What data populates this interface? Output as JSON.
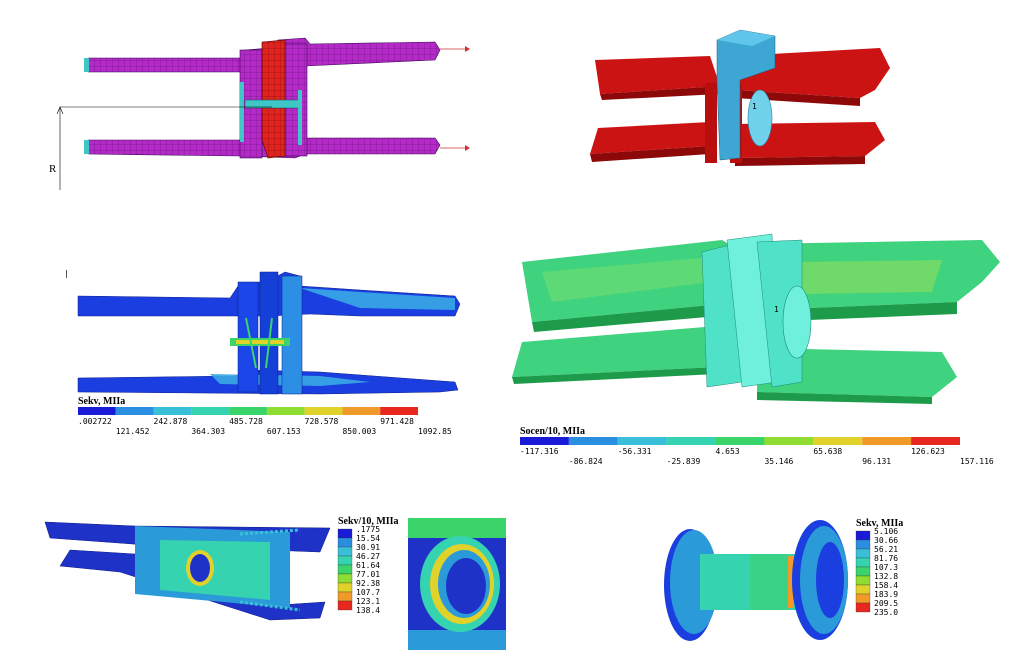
{
  "panel1": {
    "radius_label": "R"
  },
  "panel2": {
    "marker": "1"
  },
  "panel3": {
    "marker": "|",
    "scale_title": "Sekv, MIIa",
    "colors": [
      "#1a1ad9",
      "#2a8fe0",
      "#39c0d8",
      "#35d3b0",
      "#3bd46a",
      "#8fdc32",
      "#e0d22a",
      "#f09a2a",
      "#e8271e"
    ],
    "ticks_top": [
      ".002722",
      "242.878",
      "485.728",
      "728.578",
      "971.428"
    ],
    "ticks_bottom": [
      "121.452",
      "364.303",
      "607.153",
      "850.003",
      "1092.85"
    ]
  },
  "panel4": {
    "marker": "1",
    "scale_title": "Socen/10, MIIa",
    "colors": [
      "#1a1ad9",
      "#2a8fe0",
      "#39c0d8",
      "#35d3b0",
      "#3bd46a",
      "#8fdc32",
      "#e0d22a",
      "#f09a2a",
      "#e8271e"
    ],
    "ticks_top": [
      "-117.316",
      "-56.331",
      "4.653",
      "65.638",
      "126.623"
    ],
    "ticks_bottom": [
      "-86.824",
      "-25.839",
      "35.146",
      "96.131",
      "157.116"
    ]
  },
  "panel5": {
    "scale_title": "Sekv/10, MIIa",
    "colors": [
      "#1a1ad9",
      "#2a8fe0",
      "#39c0d8",
      "#35d3b0",
      "#3bd46a",
      "#8fdc32",
      "#e0d22a",
      "#f09a2a",
      "#e8271e"
    ],
    "values": [
      ".1775",
      "15.54",
      "30.91",
      "46.27",
      "61.64",
      "77.01",
      "92.38",
      "107.7",
      "123.1",
      "138.4"
    ]
  },
  "panel6": {
    "scale_title": "Sekv, MIIa",
    "colors": [
      "#1a1ad9",
      "#2a8fe0",
      "#39c0d8",
      "#35d3b0",
      "#3bd46a",
      "#8fdc32",
      "#e0d22a",
      "#f09a2a",
      "#e8271e"
    ],
    "values": [
      "5.106",
      "30.66",
      "56.21",
      "81.76",
      "107.3",
      "132.8",
      "158.4",
      "183.9",
      "209.5",
      "235.0"
    ]
  }
}
